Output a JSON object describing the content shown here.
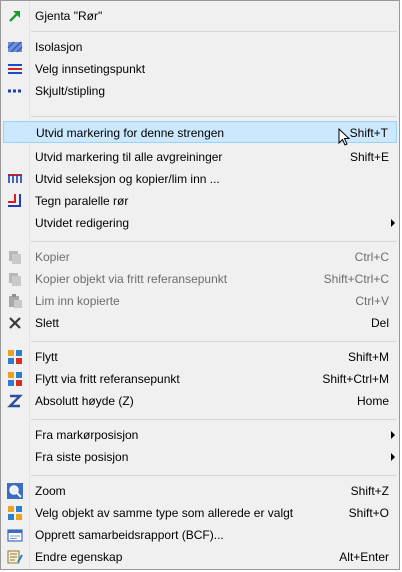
{
  "menu": {
    "items": [
      {
        "label": "Gjenta \"Rør\"",
        "shortcut": "",
        "icon": "green-arrow-icon"
      },
      {
        "label": "Isolasjon",
        "shortcut": "",
        "icon": "insulation-hatch-icon"
      },
      {
        "label": "Velg innsetingspunkt",
        "shortcut": "",
        "icon": "insertion-point-icon"
      },
      {
        "label": "Skjult/stipling",
        "shortcut": "",
        "icon": "dashed-line-icon"
      },
      {
        "label": "Utvid markering for denne strengen",
        "shortcut": "Shift+T",
        "icon": ""
      },
      {
        "label": "Utvid markering til alle avgreininger",
        "shortcut": "Shift+E",
        "icon": ""
      },
      {
        "label": "Utvid seleksjon og kopier/lim inn ...",
        "shortcut": "",
        "icon": "copy-branches-icon"
      },
      {
        "label": "Tegn paralelle rør",
        "shortcut": "",
        "icon": "parallel-pipes-icon"
      },
      {
        "label": "Utvidet redigering",
        "shortcut": "",
        "icon": ""
      },
      {
        "label": "Kopier",
        "shortcut": "Ctrl+C",
        "icon": "copy-icon"
      },
      {
        "label": "Kopier objekt via fritt referansepunkt",
        "shortcut": "Shift+Ctrl+C",
        "icon": "copy-reference-icon"
      },
      {
        "label": "Lim inn kopierte",
        "shortcut": "Ctrl+V",
        "icon": "paste-icon"
      },
      {
        "label": "Slett",
        "shortcut": "Del",
        "icon": "delete-x-icon"
      },
      {
        "label": "Flytt",
        "shortcut": "Shift+M",
        "icon": "move-icon"
      },
      {
        "label": "Flytt via fritt referansepunkt",
        "shortcut": "Shift+Ctrl+M",
        "icon": "move-reference-icon"
      },
      {
        "label": "Absolutt høyde (Z)",
        "shortcut": "Home",
        "icon": "z-height-icon"
      },
      {
        "label": "Fra markørposisjon",
        "shortcut": "",
        "icon": ""
      },
      {
        "label": "Fra siste posisjon",
        "shortcut": "",
        "icon": ""
      },
      {
        "label": "Zoom",
        "shortcut": "Shift+Z",
        "icon": "zoom-icon"
      },
      {
        "label": "Velg objekt av samme type som allerede er valgt",
        "shortcut": "Shift+O",
        "icon": "select-same-type-icon"
      },
      {
        "label": "Opprett samarbeidsrapport (BCF)...",
        "shortcut": "",
        "icon": "bcf-report-icon"
      },
      {
        "label": "Endre egenskap",
        "shortcut": "Alt+Enter",
        "icon": "properties-icon"
      }
    ]
  },
  "colors": {
    "highlight": "#cce8ff",
    "highlight_border": "#99d1ff",
    "disabled_text": "#6d6d6d"
  }
}
